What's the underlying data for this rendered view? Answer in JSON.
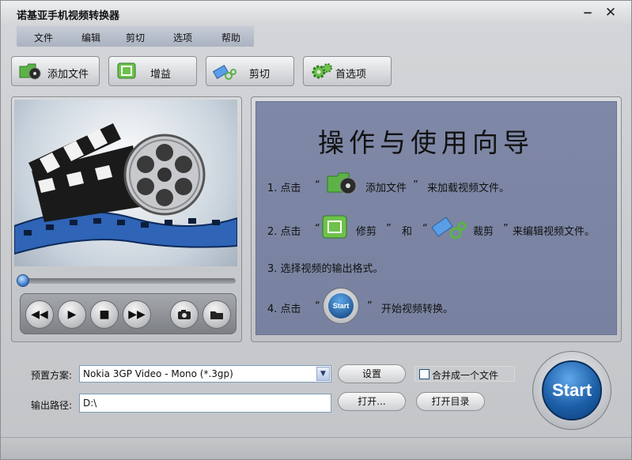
{
  "window": {
    "title": "诺基亚手机视频转换器",
    "minimize": "−",
    "close": "✕"
  },
  "menu": [
    "文件",
    "编辑",
    "剪切",
    "选项",
    "帮助"
  ],
  "toolbar": {
    "add_file": "添加文件",
    "gain": "增益",
    "cut": "剪切",
    "preferences": "首选项"
  },
  "player": {
    "position": 0
  },
  "guide": {
    "title": "操作与使用向导",
    "step1": {
      "num": "1. 点击",
      "q1": "“",
      "label": "添加文件",
      "q2": "”",
      "rest": "来加载视频文件。"
    },
    "step2": {
      "num": "2. 点击",
      "q1": "“",
      "label": "修剪",
      "q2": "”",
      "and": "和",
      "q3": "“",
      "label2": "裁剪",
      "q4": "”",
      "rest": "来编辑视频文件。"
    },
    "step3": {
      "text": "3. 选择视频的输出格式。"
    },
    "step4": {
      "num": "4. 点击",
      "q1": "“",
      "q2": "”",
      "rest": "开始视频转换。",
      "icon_label": "Start"
    }
  },
  "output": {
    "preset_label": "预置方案:",
    "preset_value": "Nokia 3GP Video - Mono (*.3gp)",
    "settings_btn": "设置",
    "merge_label": "合并成一个文件",
    "merge_checked": false,
    "path_label": "输出路径:",
    "path_value": "D:\\",
    "open_btn": "打开...",
    "open_dir_btn": "打开目录",
    "start_btn": "Start"
  },
  "colors": {
    "guide_bg": "#7f88a6",
    "start_blue": "#1d5fa8",
    "accent_green": "#4fb33a"
  }
}
